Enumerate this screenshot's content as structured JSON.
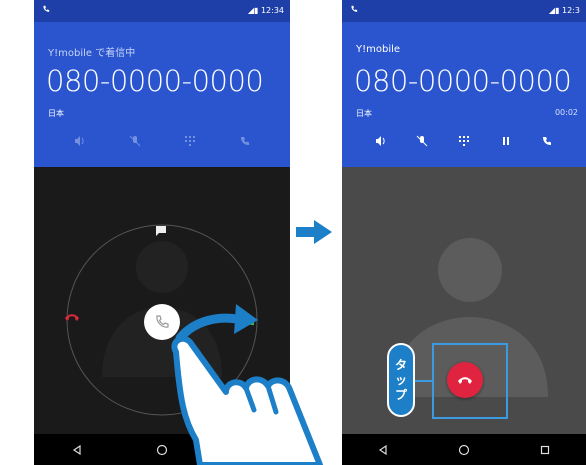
{
  "screen1": {
    "carrier": "Y!mobile で着信中",
    "number": "080-0000-0000",
    "country": "日本",
    "status_time": "12:34"
  },
  "screen2": {
    "carrier": "Y!mobile",
    "number": "080-0000-0000",
    "country": "日本",
    "timer": "00:02",
    "status_time": "12:3"
  },
  "callout": {
    "tap_label": [
      "タ",
      "ッ",
      "プ"
    ]
  },
  "colors": {
    "status_bar": "#1f3fa8",
    "header": "#2a55cf",
    "screen1_body": "#1a1a1a",
    "screen2_body": "#4a4a4a",
    "decline_red": "#d6283c",
    "answer_green": "#3bb54a",
    "callout_blue": "#1c7fc7"
  },
  "icons": {
    "action_buttons": [
      "speaker-icon",
      "mute-icon",
      "dialpad-icon",
      "hold-icon",
      "merge-call-icon"
    ],
    "incoming_controls": [
      "message-icon",
      "decline-icon",
      "answer-handle-icon",
      "accept-icon"
    ],
    "nav": [
      "back-icon",
      "home-icon",
      "recents-icon"
    ]
  }
}
